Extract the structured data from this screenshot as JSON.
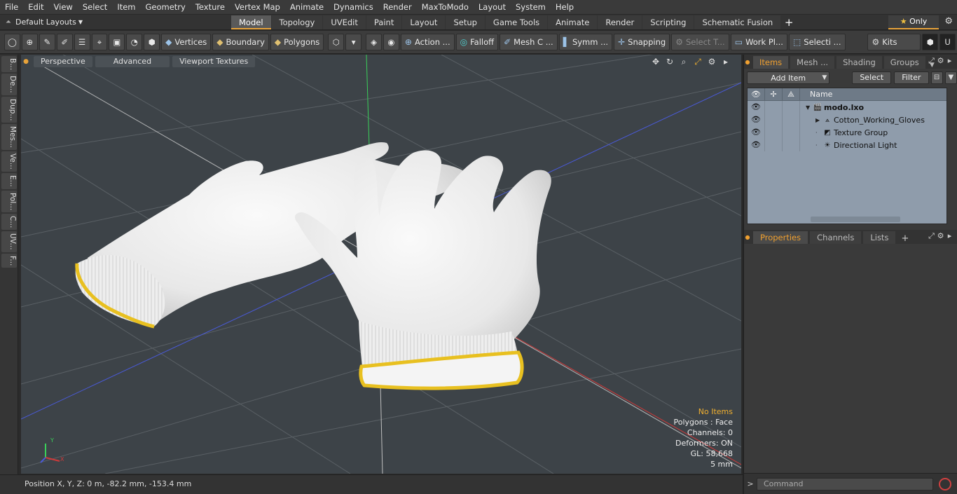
{
  "menu": [
    "File",
    "Edit",
    "View",
    "Select",
    "Item",
    "Geometry",
    "Texture",
    "Vertex Map",
    "Animate",
    "Dynamics",
    "Render",
    "MaxToModo",
    "Layout",
    "System",
    "Help"
  ],
  "layout_selector": "Default Layouts",
  "tabs": [
    {
      "label": "Model",
      "active": true
    },
    {
      "label": "Topology",
      "active": false
    },
    {
      "label": "UVEdit",
      "active": false
    },
    {
      "label": "Paint",
      "active": false
    },
    {
      "label": "Layout",
      "active": false
    },
    {
      "label": "Setup",
      "active": false
    },
    {
      "label": "Game Tools",
      "active": false
    },
    {
      "label": "Animate",
      "active": false
    },
    {
      "label": "Render",
      "active": false
    },
    {
      "label": "Scripting",
      "active": false
    },
    {
      "label": "Schematic Fusion",
      "active": false
    }
  ],
  "only_label": "Only",
  "toolbar": {
    "vertices": "Vertices",
    "boundary": "Boundary",
    "polygons": "Polygons",
    "action": "Action ...",
    "falloff": "Falloff",
    "mesh": "Mesh C ...",
    "symm": "Symm ...",
    "snapping": "Snapping",
    "select_t": "Select T...",
    "workplane": "Work Pl...",
    "selecti": "Selecti ...",
    "kits": "Kits"
  },
  "left_tabs": [
    "B...",
    "De...",
    "Dup...",
    "Mes...",
    "Ve...",
    "E...",
    "Pol...",
    "C...",
    "UV...",
    "F..."
  ],
  "viewport": {
    "perspective": "Perspective",
    "advanced": "Advanced",
    "textures": "Viewport Textures",
    "info": {
      "no_items": "No Items",
      "polygons": "Polygons : Face",
      "channels": "Channels: 0",
      "deformers": "Deformers: ON",
      "gl": "GL: 58,668",
      "scale": "5 mm"
    },
    "colors": {
      "background": "#3d4348",
      "grid": "#5a6065",
      "x_axis": "#d03a3a",
      "y_axis": "#3ad05a",
      "z_axis": "#4a5ad8",
      "glove": "#f2f2f2",
      "cuff": "#e8c020"
    }
  },
  "status": "Position X, Y, Z:   0 m, -82.2 mm, -153.4 mm",
  "right": {
    "tabs": [
      {
        "label": "Items",
        "active": true
      },
      {
        "label": "Mesh ...",
        "active": false
      },
      {
        "label": "Shading",
        "active": false
      },
      {
        "label": "Groups",
        "active": false
      }
    ],
    "add_item": "Add Item",
    "select": "Select",
    "filter": "Filter",
    "name_col": "Name",
    "tree": [
      {
        "label": "modo.lxo",
        "bold": true,
        "depth": 0,
        "icon": "scene-icon",
        "expanded": true
      },
      {
        "label": "Cotton_Working_Gloves",
        "bold": false,
        "depth": 1,
        "icon": "mesh-icon",
        "expanded": false
      },
      {
        "label": "Texture Group",
        "bold": false,
        "depth": 1,
        "icon": "texture-icon",
        "expanded": null
      },
      {
        "label": "Directional Light",
        "bold": false,
        "depth": 1,
        "icon": "light-icon",
        "expanded": null
      }
    ],
    "bottom_tabs": [
      {
        "label": "Properties",
        "active": true
      },
      {
        "label": "Channels",
        "active": false
      },
      {
        "label": "Lists",
        "active": false
      }
    ],
    "command_placeholder": "Command"
  }
}
